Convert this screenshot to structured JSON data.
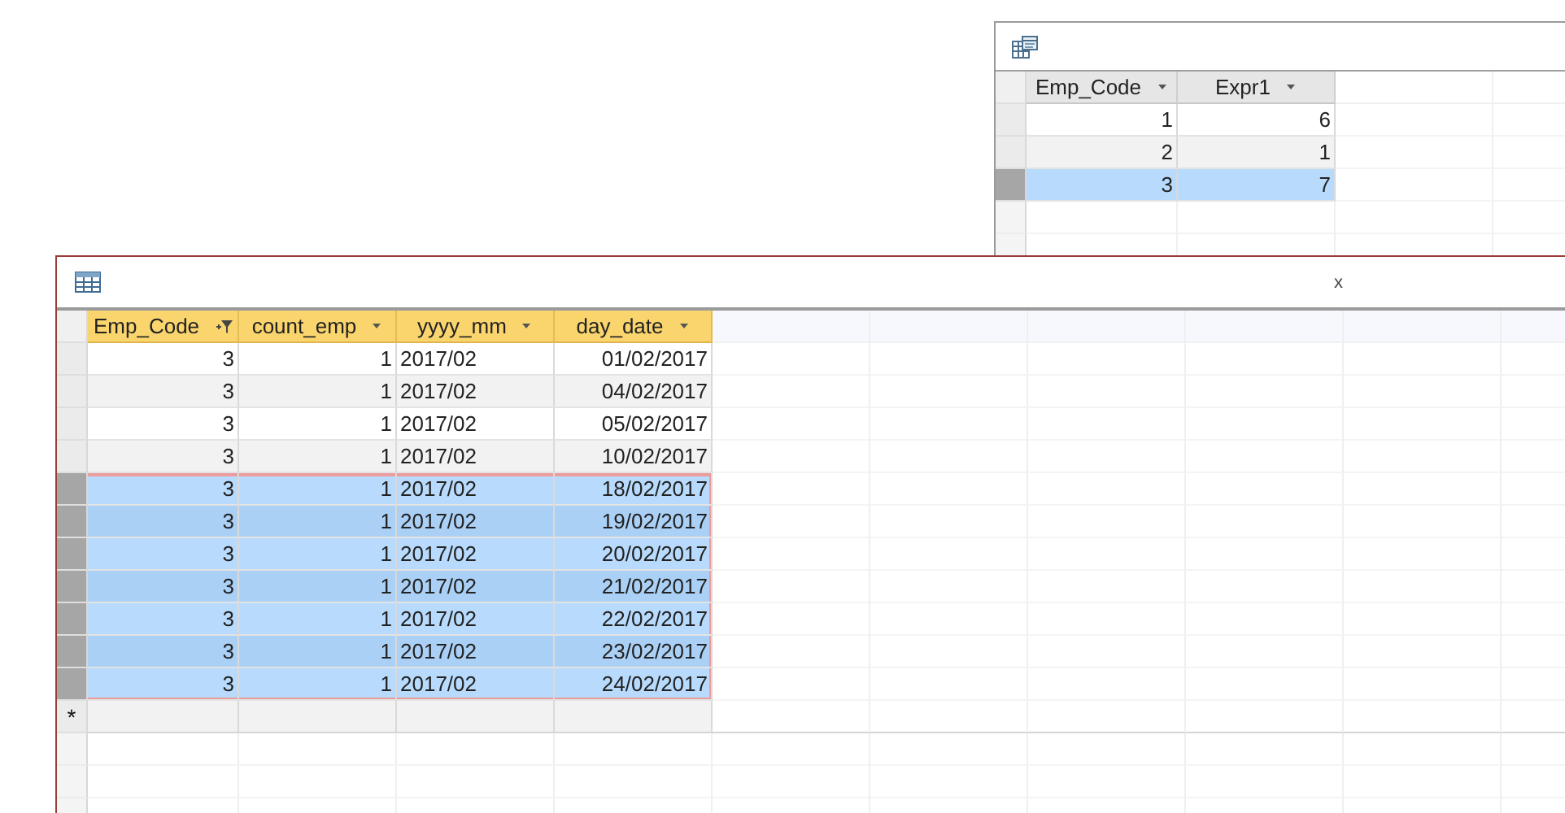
{
  "windows": [
    {
      "kind": "query",
      "active": false,
      "columns": [
        {
          "label": "Emp_Code",
          "filtered": false,
          "kind": "number"
        },
        {
          "label": "Expr1",
          "filtered": false,
          "kind": "number"
        }
      ],
      "rows": [
        {
          "cells": [
            "1",
            "6"
          ],
          "selected": false
        },
        {
          "cells": [
            "2",
            "1"
          ],
          "selected": false
        },
        {
          "cells": [
            "3",
            "7"
          ],
          "selected": true
        }
      ]
    },
    {
      "kind": "table",
      "active": true,
      "close_label": "x",
      "new_record_mark": "*",
      "columns": [
        {
          "label": "Emp_Code",
          "filtered": true,
          "kind": "number"
        },
        {
          "label": "count_emp",
          "filtered": false,
          "kind": "number"
        },
        {
          "label": "yyyy_mm",
          "filtered": false,
          "kind": "text"
        },
        {
          "label": "day_date",
          "filtered": false,
          "kind": "number"
        }
      ],
      "rows": [
        {
          "cells": [
            "3",
            "1",
            "2017/02",
            "01/02/2017"
          ],
          "selected": false
        },
        {
          "cells": [
            "3",
            "1",
            "2017/02",
            "04/02/2017"
          ],
          "selected": false
        },
        {
          "cells": [
            "3",
            "1",
            "2017/02",
            "05/02/2017"
          ],
          "selected": false
        },
        {
          "cells": [
            "3",
            "1",
            "2017/02",
            "10/02/2017"
          ],
          "selected": false
        },
        {
          "cells": [
            "3",
            "1",
            "2017/02",
            "18/02/2017"
          ],
          "selected": true
        },
        {
          "cells": [
            "3",
            "1",
            "2017/02",
            "19/02/2017"
          ],
          "selected": true
        },
        {
          "cells": [
            "3",
            "1",
            "2017/02",
            "20/02/2017"
          ],
          "selected": true
        },
        {
          "cells": [
            "3",
            "1",
            "2017/02",
            "21/02/2017"
          ],
          "selected": true
        },
        {
          "cells": [
            "3",
            "1",
            "2017/02",
            "22/02/2017"
          ],
          "selected": true
        },
        {
          "cells": [
            "3",
            "1",
            "2017/02",
            "23/02/2017"
          ],
          "selected": true
        },
        {
          "cells": [
            "3",
            "1",
            "2017/02",
            "24/02/2017"
          ],
          "selected": true
        }
      ]
    }
  ]
}
